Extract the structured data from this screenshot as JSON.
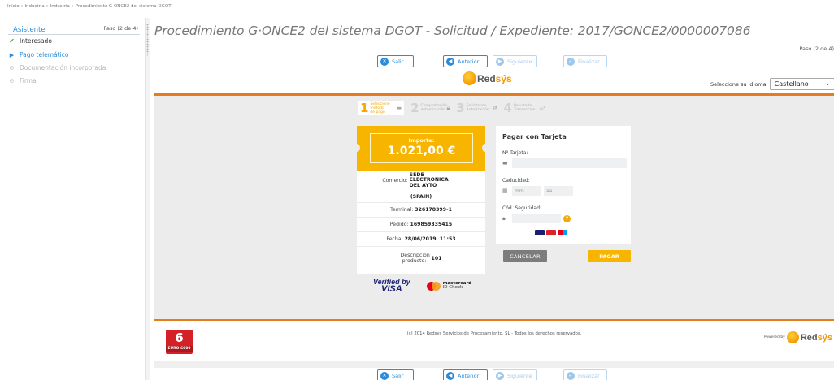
{
  "breadcrumb": [
    "Inicio",
    "»",
    "Industria",
    "»",
    "Industria",
    "»",
    "Procedimiento G·ONCE2 del sistema DGOT"
  ],
  "sidebar": {
    "title": "Asistente",
    "step": "Paso (2 de 4)",
    "items": [
      {
        "label": "Interesado",
        "icon": "check-icon",
        "glyph": "✔"
      },
      {
        "label": "Pago telemático",
        "icon": "play-icon",
        "glyph": "▶"
      },
      {
        "label": "Documentación incorporada",
        "icon": "disabled-icon",
        "glyph": "⊘"
      },
      {
        "label": "Firma",
        "icon": "disabled-icon",
        "glyph": "⊘"
      }
    ]
  },
  "page": {
    "title": "Procedimiento G·ONCE2 del sistema DGOT - Solicitud / Expediente: 2017/GONCE2/0000007086",
    "step": "Paso (2 de 4)"
  },
  "wizard": {
    "salir": "Salir",
    "anterior": "Anterior",
    "siguiente": "Siguiente",
    "finalizar": "Finalizar"
  },
  "redsys": {
    "brand_a": "Red",
    "brand_b": "sýs",
    "language_label": "Seleccione su idioma",
    "language_value": "Castellano"
  },
  "progress": [
    {
      "num": "1",
      "label": "Seleccione método de pago",
      "active": true
    },
    {
      "num": "2",
      "label": "Comprobación autenticación"
    },
    {
      "num": "3",
      "label": "Solicitando Autorización"
    },
    {
      "num": "4",
      "label": "Resultado Transacción"
    }
  ],
  "payment": {
    "amount_label": "Importe:",
    "amount_value": "1.021,00 €",
    "comercio_label": "Comercio:",
    "comercio_value": "SEDE ELECTRONICA DEL AYTO",
    "comercio_extra": "(SPAIN)",
    "terminal_label": "Terminal:",
    "terminal_value": "326178399-1",
    "pedido_label": "Pedido:",
    "pedido_value": "169859335415",
    "fecha_label": "Fecha:",
    "fecha_value": "28/06/2019  11:53",
    "desc_label": "Descripción producto:",
    "desc_value": "101"
  },
  "card_form": {
    "title": "Pagar con Tarjeta",
    "card_label": "Nº Tarjeta:",
    "expiry_label": "Caducidad:",
    "month_placeholder": "mm",
    "year_placeholder": "aa",
    "cvv_label": "Cód. Seguridad:",
    "help": "?"
  },
  "actions": {
    "cancel": "CANCELAR",
    "pay": "PAGAR"
  },
  "badges": {
    "vbv_line1": "Verified by",
    "vbv_line2": "VISA",
    "mc_line1": "mastercard",
    "mc_line2": "ID Check"
  },
  "footer": {
    "copyright": "(c) 2014 Redsys Servicios de Procesamiento. SL - Todos los derechos reservados.",
    "powered_by": "Powered by",
    "euro_big": "6",
    "euro_small": "EURO 6000"
  },
  "colors": {
    "accent_blue": "#2c8bd8",
    "redsys_orange": "#e37d1e",
    "amount_yellow": "#f7b500",
    "success_green": "#3ba53b"
  }
}
